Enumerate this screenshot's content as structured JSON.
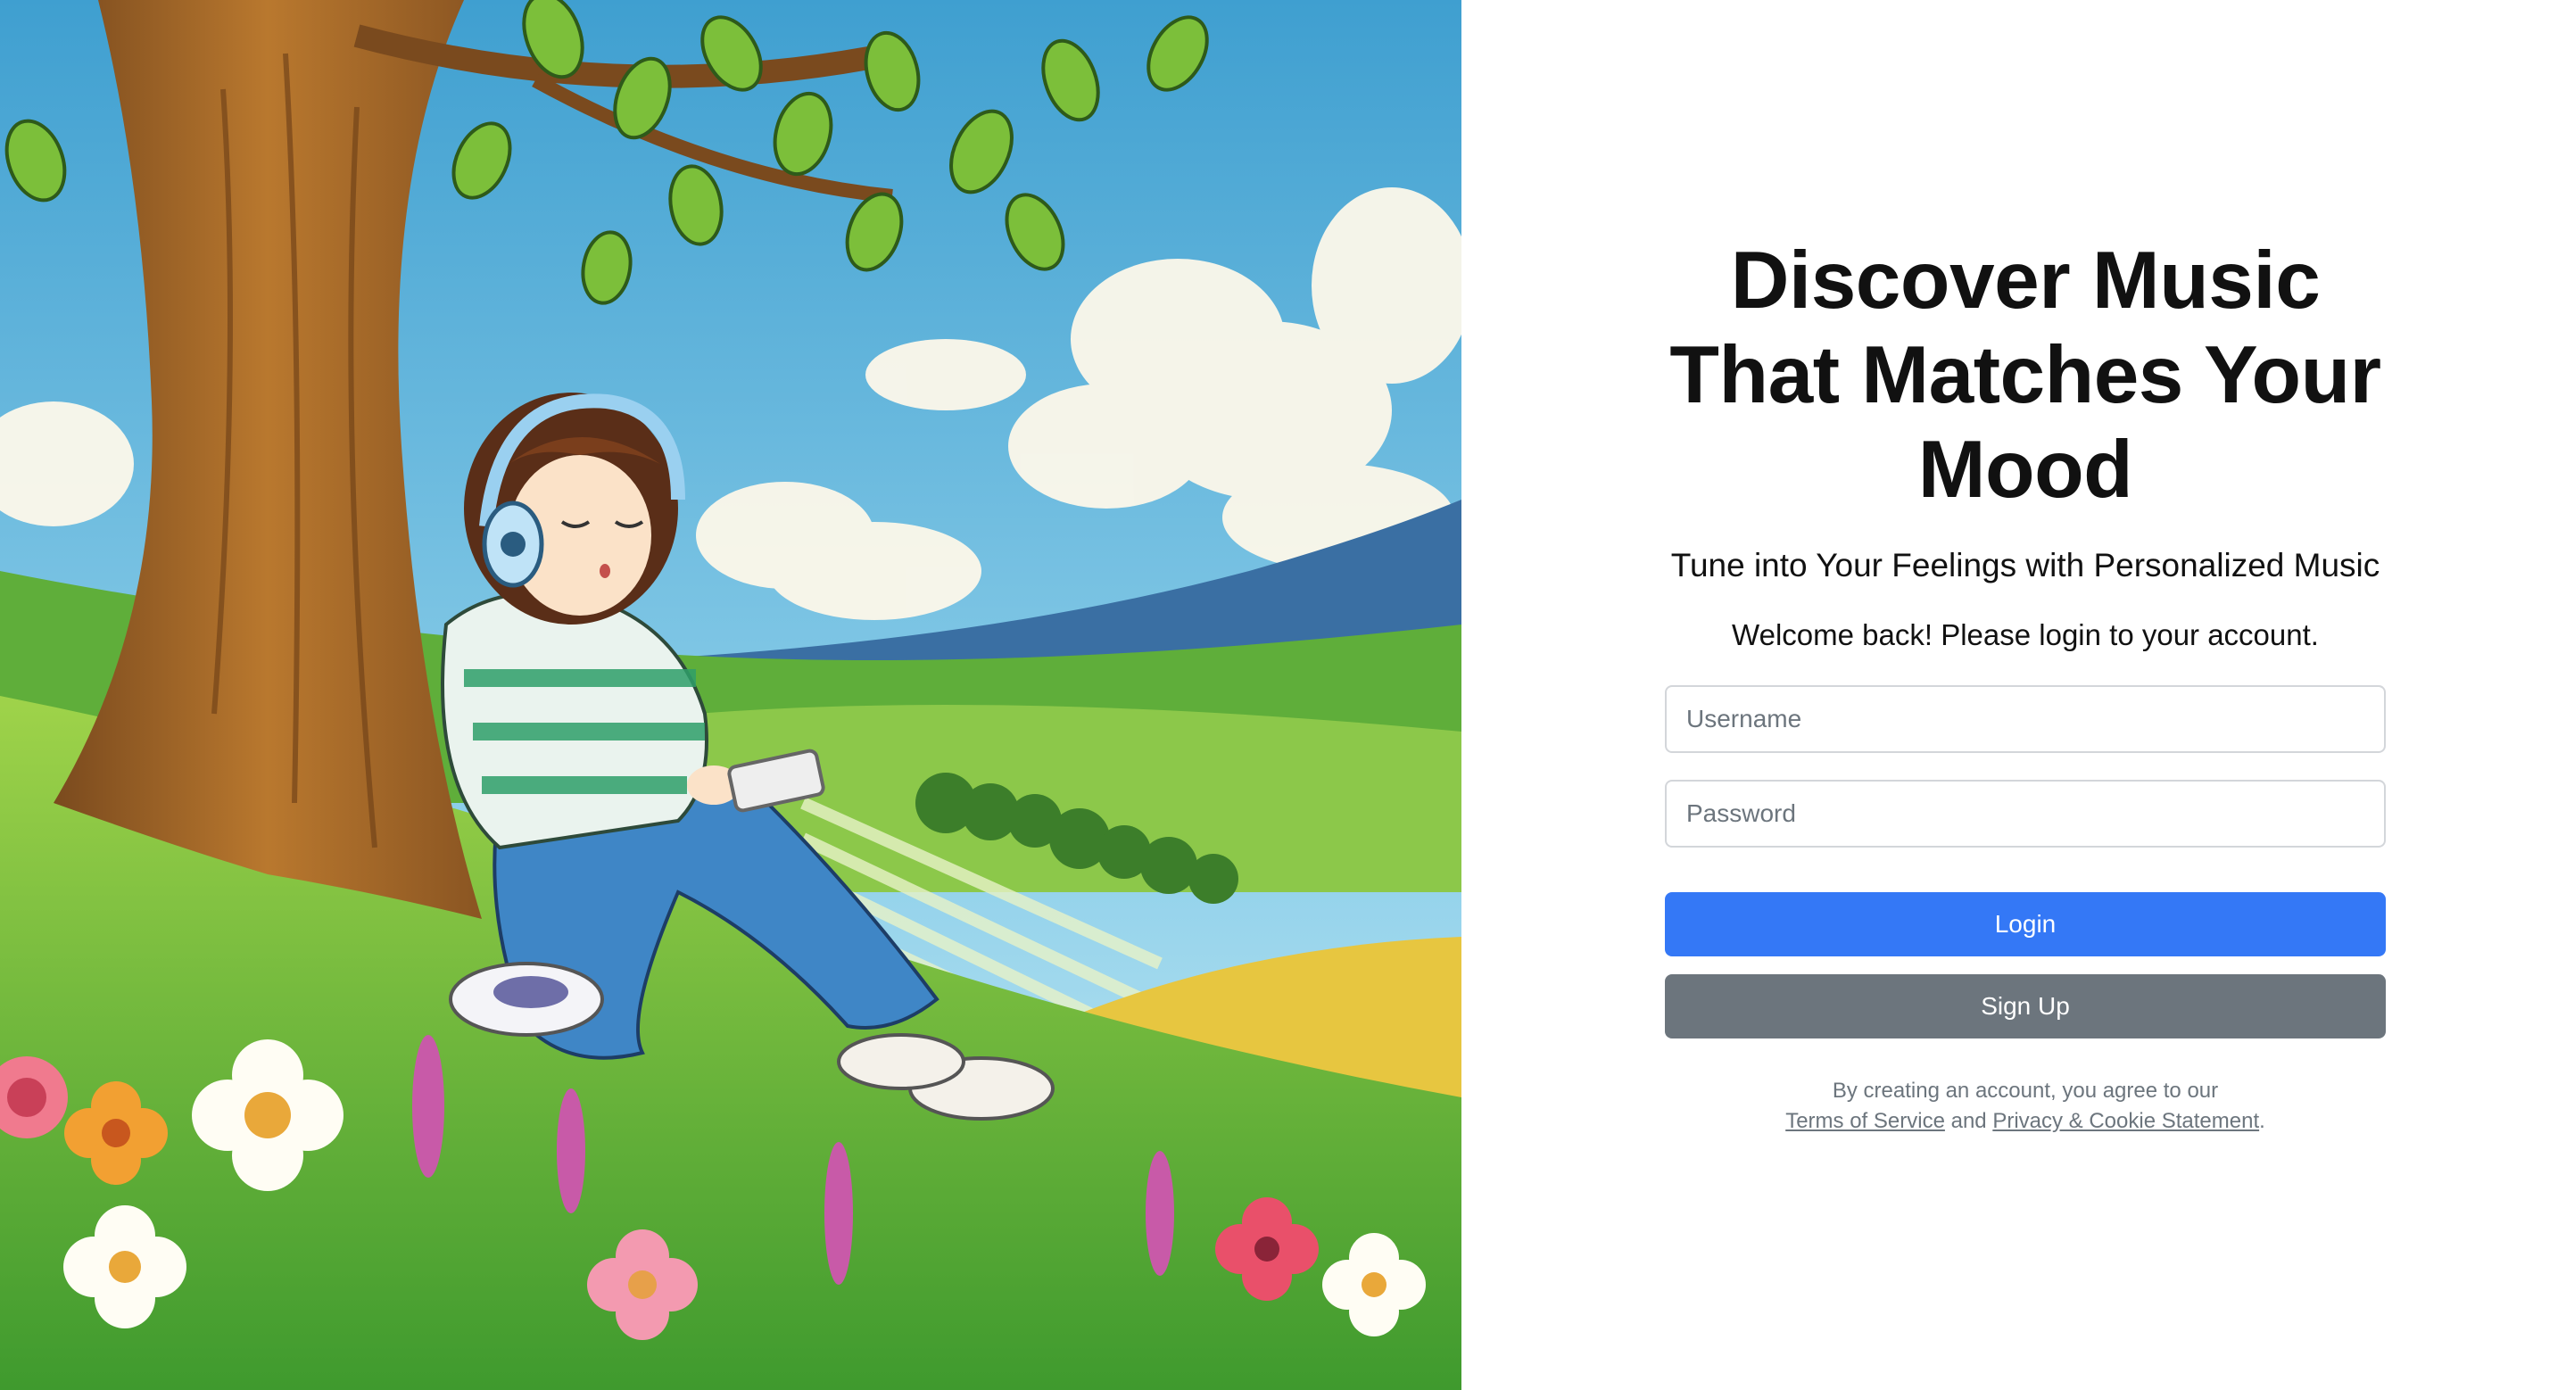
{
  "hero": {
    "image_description_icon": "illustration-girl-headphones-under-tree"
  },
  "auth": {
    "headline": "Discover Music That Matches Your Mood",
    "subtitle": "Tune into Your Feelings with Personalized Music",
    "welcome": "Welcome back! Please login to your account.",
    "username_placeholder": "Username",
    "username_value": "",
    "password_placeholder": "Password",
    "password_value": "",
    "login_label": "Login",
    "signup_label": "Sign Up",
    "legal_prefix": "By creating an account, you agree to our",
    "terms_label": "Terms of Service",
    "legal_and": "and",
    "privacy_label": "Privacy & Cookie Statement",
    "legal_suffix": "."
  },
  "colors": {
    "primary": "#3478f6",
    "secondary": "#6c757d",
    "text": "#111111",
    "muted": "#6c757d"
  }
}
